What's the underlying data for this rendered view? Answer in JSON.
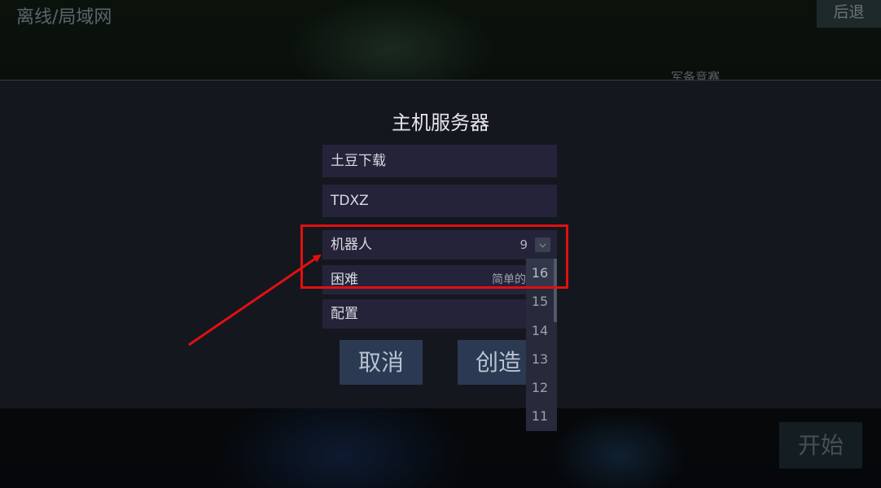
{
  "top_bar": {
    "title": "离线/局域网",
    "back_label": "后退"
  },
  "background": {
    "partial_label": "军备竞赛",
    "start_label": "开始"
  },
  "dialog": {
    "title": "主机服务器",
    "server_name": "土豆下载",
    "password": "TDXZ",
    "bots": {
      "label": "机器人",
      "value": "9",
      "dropdown_icon": "chevron-down-icon"
    },
    "difficulty": {
      "label": "困难",
      "value": "简单的"
    },
    "config": {
      "label": "配置"
    },
    "cancel_label": "取消",
    "create_label": "创造",
    "bots_options": [
      "16",
      "15",
      "14",
      "13",
      "12",
      "11"
    ]
  },
  "annotation": {
    "color": "#e01010"
  }
}
